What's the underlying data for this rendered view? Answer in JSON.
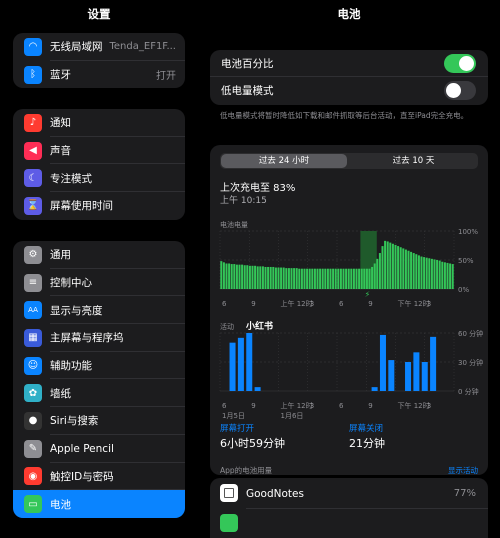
{
  "sidebar": {
    "title": "设置",
    "group1": [
      {
        "label": "无线局域网",
        "value": "Tenda_EF1F...",
        "icon": "wifi-icon",
        "color": "#0a84ff"
      },
      {
        "label": "蓝牙",
        "value": "打开",
        "icon": "bluetooth-icon",
        "color": "#0a84ff"
      }
    ],
    "group2": [
      {
        "label": "通知",
        "icon": "bell-icon",
        "color": "#ff3b30"
      },
      {
        "label": "声音",
        "icon": "speaker-icon",
        "color": "#ff2d55"
      },
      {
        "label": "专注模式",
        "icon": "moon-icon",
        "color": "#5e5ce6"
      },
      {
        "label": "屏幕使用时间",
        "icon": "hourglass-icon",
        "color": "#5e5ce6"
      }
    ],
    "group3": [
      {
        "label": "通用",
        "icon": "gear-icon",
        "color": "#8e8e93"
      },
      {
        "label": "控制中心",
        "icon": "switches-icon",
        "color": "#8e8e93"
      },
      {
        "label": "显示与亮度",
        "icon": "aa-icon",
        "color": "#0a84ff"
      },
      {
        "label": "主屏幕与程序坞",
        "icon": "grid-icon",
        "color": "#3a5bd9"
      },
      {
        "label": "辅助功能",
        "icon": "accessibility-icon",
        "color": "#0a84ff"
      },
      {
        "label": "墙纸",
        "icon": "flower-icon",
        "color": "#30b0c7"
      },
      {
        "label": "Siri与搜索",
        "icon": "siri-icon",
        "color": "#333"
      },
      {
        "label": "Apple Pencil",
        "icon": "pencil-icon",
        "color": "#8e8e93"
      },
      {
        "label": "触控ID与密码",
        "icon": "fingerprint-icon",
        "color": "#ff3b30"
      },
      {
        "label": "电池",
        "icon": "battery-icon",
        "color": "#34c759"
      }
    ]
  },
  "main": {
    "title": "电池",
    "battery_percent_label": "电池百分比",
    "battery_percent_on": true,
    "low_power_label": "低电量模式",
    "low_power_on": false,
    "low_power_note": "低电量模式将暂时降低如下载和邮件抓取等后台活动，直至iPad完全充电。",
    "tabs": [
      "过去 24 小时",
      "过去 10 天"
    ],
    "last_charge_title": "上次充电至 83%",
    "last_charge_time": "上午 10:15",
    "level_chart_label": "电池电量",
    "activity_chart_label": "活动",
    "screen_on_label": "屏幕打开",
    "screen_on_value": "6小时59分钟",
    "screen_off_label": "屏幕关闭",
    "screen_off_value": "21分钟",
    "app_usage_label": "App的电池用量",
    "show_activity": "显示活动",
    "apps": [
      {
        "name": "GoodNotes",
        "percent": "77%"
      }
    ],
    "watermark": "小红书",
    "colors": {
      "green": "#34c759",
      "blue": "#0a84ff"
    }
  },
  "chart_data": [
    {
      "type": "bar",
      "title": "电池电量",
      "ylabels": [
        "100%",
        "50%",
        "0%"
      ],
      "ylim": [
        0,
        100
      ],
      "xlabels": [
        "6",
        "9",
        "上午 12时",
        "3",
        "6",
        "9",
        "下午 12时",
        "3"
      ],
      "charging_window": [
        0.6,
        0.67
      ],
      "values": [
        48,
        46,
        44,
        44,
        43,
        43,
        42,
        42,
        42,
        41,
        41,
        40,
        40,
        40,
        39,
        39,
        39,
        38,
        38,
        38,
        38,
        37,
        37,
        37,
        37,
        36,
        36,
        36,
        36,
        36,
        35,
        35,
        35,
        35,
        35,
        35,
        35,
        35,
        35,
        35,
        35,
        35,
        35,
        35,
        35,
        35,
        35,
        35,
        35,
        35,
        35,
        35,
        35,
        35,
        35,
        35,
        35,
        35,
        38,
        44,
        52,
        62,
        74,
        83,
        82,
        80,
        78,
        76,
        74,
        72,
        70,
        68,
        66,
        64,
        62,
        60,
        58,
        56,
        55,
        54,
        53,
        52,
        51,
        50,
        49,
        47,
        46,
        45,
        44,
        43
      ]
    },
    {
      "type": "bar",
      "title": "活动",
      "ylabels": [
        "60 分钟",
        "30 分钟",
        "0 分钟"
      ],
      "ylim": [
        0,
        60
      ],
      "xlabels": [
        "6",
        "9",
        "上午 12时",
        "3",
        "6",
        "9",
        "下午 12时",
        "3"
      ],
      "xsublabels": [
        "1月5日",
        "1月6日"
      ],
      "values": [
        0,
        50,
        55,
        60,
        4,
        0,
        0,
        0,
        0,
        0,
        0,
        0,
        0,
        0,
        0,
        0,
        0,
        0,
        4,
        58,
        32,
        0,
        30,
        40,
        30,
        56,
        0,
        0
      ]
    }
  ]
}
